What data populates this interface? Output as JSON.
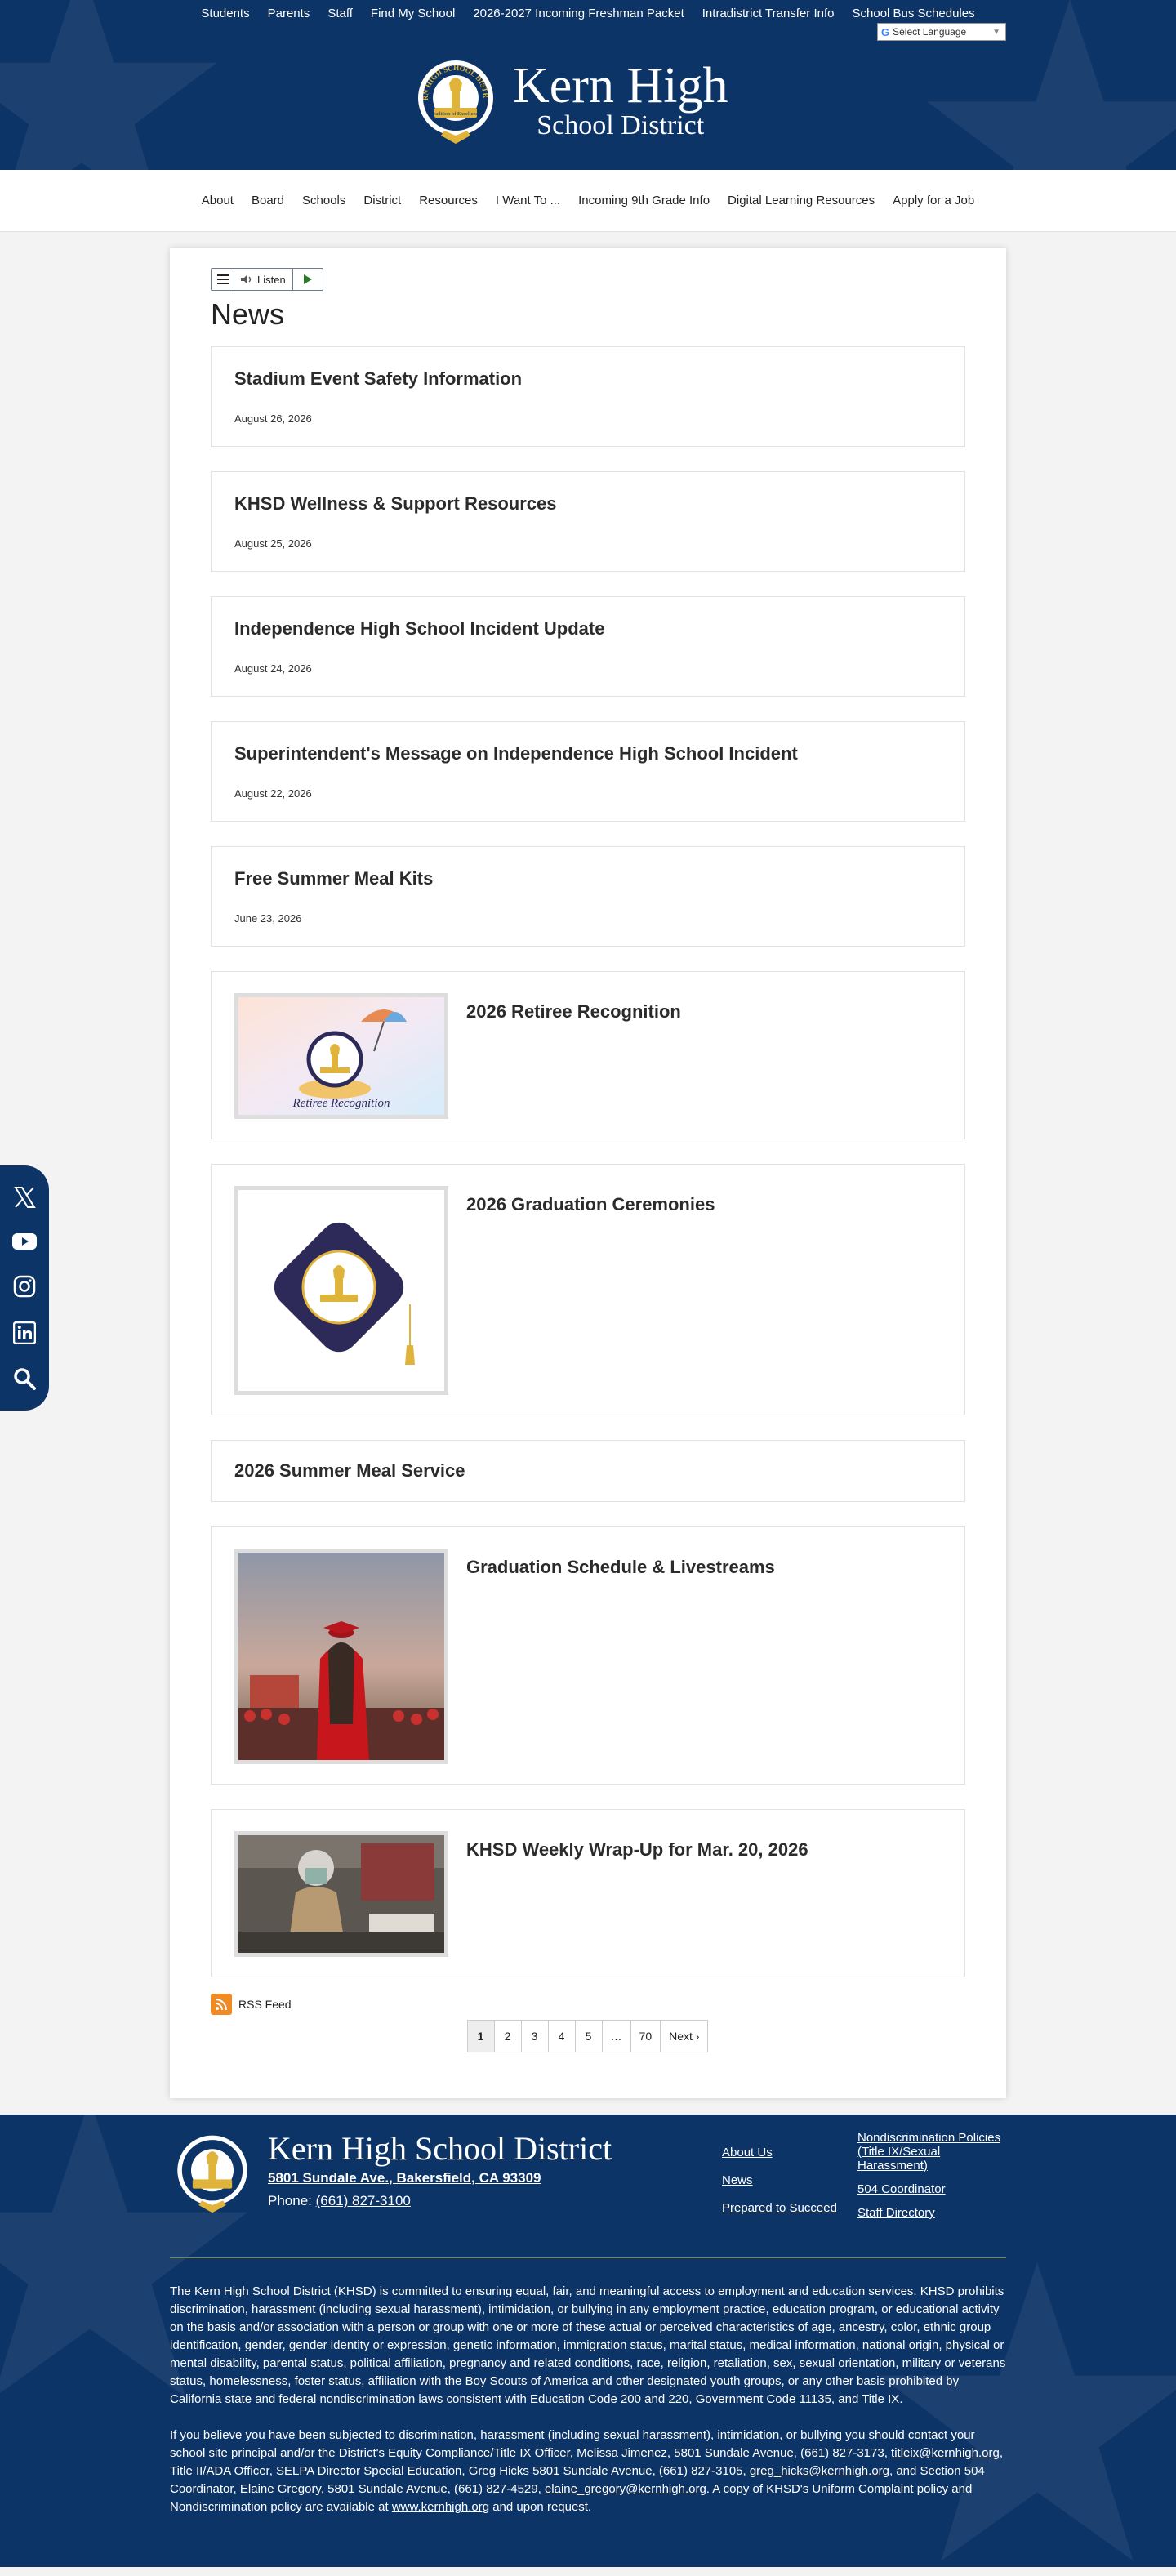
{
  "header": {
    "top_links": [
      "Students",
      "Parents",
      "Staff",
      "Find My School",
      "2026-2027 Incoming Freshman Packet",
      "Intradistrict Transfer Info",
      "School Bus Schedules"
    ],
    "language_label": "Select Language",
    "title_line1": "Kern High",
    "title_line2": "School District",
    "logo_ring_text": "KERN HIGH SCHOOL DISTRICT",
    "logo_banner_text": "Tradition of Excellence",
    "logo_icon": "torch-seal-icon"
  },
  "nav": [
    "About",
    "Board",
    "Schools",
    "District",
    "Resources",
    "I Want To ...",
    "Incoming 9th Grade Info",
    "Digital Learning Resources",
    "Apply for a Job"
  ],
  "listen": {
    "label": "Listen"
  },
  "page_title": "News",
  "articles": [
    {
      "title": "Stadium Event Safety Information",
      "date": "August 26, 2026"
    },
    {
      "title": "KHSD Wellness & Support Resources",
      "date": "August 25, 2026"
    },
    {
      "title": "Independence High School Incident Update",
      "date": "August 24, 2026"
    },
    {
      "title": "Superintendent's Message on Independence High School Incident",
      "date": "August 22, 2026"
    },
    {
      "title": "Free Summer Meal Kits",
      "date": "June 23, 2026"
    },
    {
      "title": "2026 Retiree Recognition",
      "thumb_caption": "Retiree Recognition"
    },
    {
      "title": "2026 Graduation Ceremonies"
    },
    {
      "title": "2026 Summer Meal Service"
    },
    {
      "title": "Graduation Schedule & Livestreams"
    },
    {
      "title": "KHSD Weekly Wrap-Up for Mar. 20, 2026"
    }
  ],
  "rss_label": "RSS Feed",
  "pagination": [
    "1",
    "2",
    "3",
    "4",
    "5",
    "…",
    "70",
    "Next ›"
  ],
  "social": [
    "x-icon",
    "youtube-icon",
    "instagram-icon",
    "linkedin-icon",
    "search-icon"
  ],
  "footer": {
    "name": "Kern High School District",
    "address": "5801 Sundale Ave., Bakersfield, CA 93309",
    "phone_label": "Phone: ",
    "phone": "(661) 827-3100",
    "links_col1": [
      "About Us",
      "News",
      "Prepared to Succeed"
    ],
    "links_col2": [
      "Nondiscrimination Policies (Title IX/Sexual Harassment)",
      "504 Coordinator",
      "Staff Directory"
    ],
    "para1": "The Kern High School District (KHSD) is committed to ensuring equal, fair, and meaningful access to employment and education services. KHSD prohibits discrimination, harassment (including sexual harassment), intimidation, or bullying in any employment practice, education program, or educational activity on the basis and/or association with a person or group with one or more of these actual or perceived characteristics of age, ancestry, color, ethnic group identification, gender, gender identity or expression, genetic information, immigration status, marital status, medical information, national origin, physical or mental disability, parental status, political affiliation, pregnancy and related conditions, race, religion, retaliation, sex, sexual orientation, military or veterans status, homelessness, foster status, affiliation with the Boy Scouts of America and other designated youth groups, or any other basis prohibited by California state and federal nondiscrimination laws consistent with Education Code 200 and 220, Government Code 11135, and Title IX.",
    "para2_a": "If you believe you have been subjected to discrimination, harassment (including sexual harassment), intimidation, or bullying you should contact your school site principal and/or the District's Equity Compliance/Title IX Officer, Melissa Jimenez, 5801 Sundale Avenue, (661) 827-3173, ",
    "para2_email1": "titleix@kernhigh.org",
    "para2_b": ", Title II/ADA Officer, SELPA Director Special Education, Greg Hicks 5801 Sundale Avenue, (661) 827-3105, ",
    "para2_email2": "greg_hicks@kernhigh.org",
    "para2_c": ", and Section 504 Coordinator, Elaine Gregory, 5801 Sundale Avenue, (661) 827-4529, ",
    "para2_email3": "elaine_gregory@kernhigh.org",
    "para2_d": ".  A copy of KHSD's Uniform Complaint policy and Nondiscrimination policy are available at ",
    "para2_site": "www.kernhigh.org",
    "para2_e": " and upon request."
  },
  "colors": {
    "navy": "#0d3466",
    "gold": "#e0b43a",
    "rss": "#f08a24"
  }
}
